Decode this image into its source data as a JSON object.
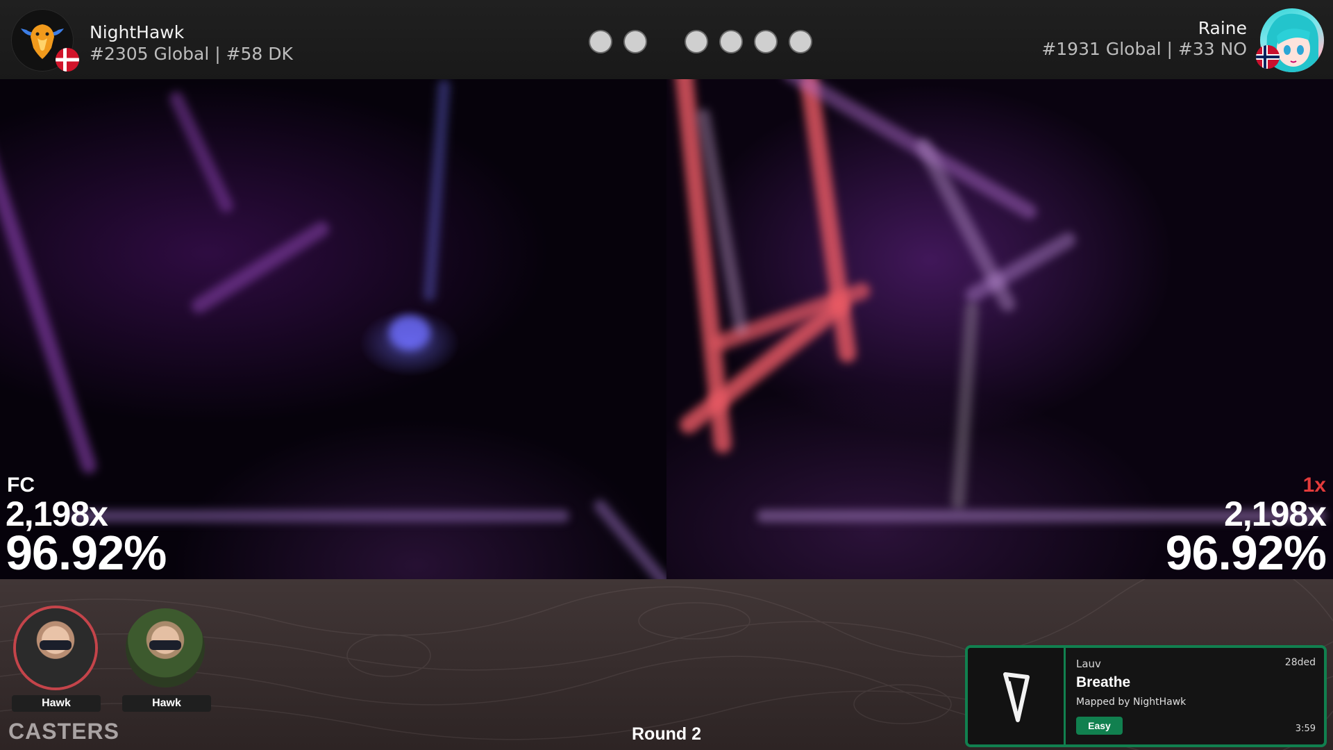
{
  "player_left": {
    "name": "NightHawk",
    "rank": "#2305 Global | #58 DK",
    "avatar_icon": "eagle-logo-icon",
    "flag": "denmark-flag-icon",
    "status": "FC",
    "combo": "2,198x",
    "accuracy": "96.92%"
  },
  "player_right": {
    "name": "Raine",
    "rank": "#1931 Global | #33 NO",
    "avatar_icon": "anime-avatar-icon",
    "flag": "norway-flag-icon",
    "status": "1x",
    "combo": "2,198x",
    "accuracy": "96.92%"
  },
  "score_dots": {
    "left_count": 2,
    "right_count": 4
  },
  "casters": {
    "title": "CASTERS",
    "people": [
      {
        "name": "Hawk",
        "active": true
      },
      {
        "name": "Hawk",
        "active": false
      }
    ]
  },
  "round": "Round 2",
  "song": {
    "artist": "Lauv",
    "id": "28ded",
    "title": "Breathe",
    "mapper": "Mapped by NightHawk",
    "difficulty": "Easy",
    "length": "3:59"
  },
  "colors": {
    "accent_green": "#11804f",
    "miss_red": "#e33b3b",
    "active_caster_ring": "#c4444a"
  }
}
